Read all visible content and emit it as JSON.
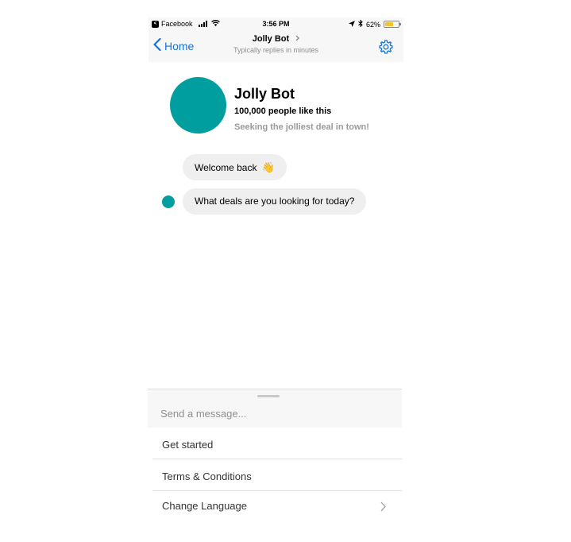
{
  "status_bar": {
    "app_back": "Facebook",
    "time": "3:56 PM",
    "battery": "62%",
    "battery_level": 0.62
  },
  "nav": {
    "back_label": "Home",
    "title": "Jolly Bot",
    "subtitle": "Typically replies in minutes"
  },
  "profile": {
    "name": "Jolly Bot",
    "likes": "100,000 people like this",
    "tagline": "Seeking the jolliest deal in town!"
  },
  "messages": [
    {
      "text": "Welcome back",
      "emoji": "👋"
    },
    {
      "text": "What deals are you looking for today?"
    }
  ],
  "composer": {
    "placeholder": "Send a message..."
  },
  "menu": {
    "items": [
      {
        "label": "Get started"
      },
      {
        "label": "Terms & Conditions"
      },
      {
        "label": "Change Language"
      }
    ]
  },
  "colors": {
    "accent": "#1a74d8",
    "bot": "#009e9f",
    "bubble": "#efefef",
    "battery": "#f4c430"
  }
}
